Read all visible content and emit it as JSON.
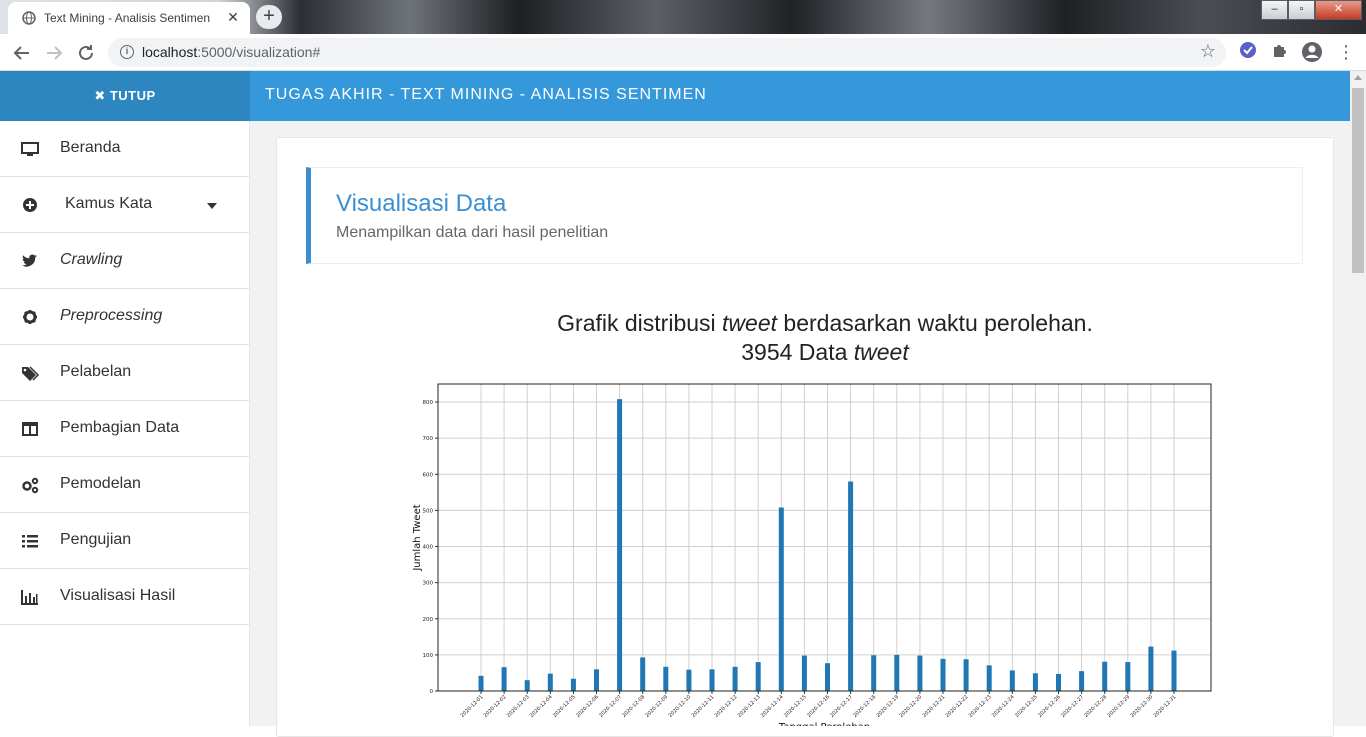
{
  "browser": {
    "tab_title": "Text Mining - Analisis Sentimen",
    "tab_close": "✕",
    "new_tab": "+",
    "url_host": "localhost",
    "url_rest": ":5000/visualization#",
    "win_min": "–",
    "win_max": "▫",
    "win_close": "✕"
  },
  "header": {
    "toggle_label": "✖ TUTUP",
    "app_title": "TUGAS AKHIR - TEXT MINING - ANALISIS SENTIMEN"
  },
  "sidebar": {
    "items": [
      {
        "label": "Beranda",
        "icon": "monitor-icon"
      },
      {
        "label": "Kamus Kata",
        "icon": "plus-circle-icon"
      },
      {
        "label": "Crawling",
        "icon": "twitter-icon"
      },
      {
        "label": "Preprocessing",
        "icon": "gear-icon"
      },
      {
        "label": "Pelabelan",
        "icon": "tags-icon"
      },
      {
        "label": "Pembagian Data",
        "icon": "columns-icon"
      },
      {
        "label": "Pemodelan",
        "icon": "gears-icon"
      },
      {
        "label": "Pengujian",
        "icon": "list-icon"
      },
      {
        "label": "Visualisasi Hasil",
        "icon": "bar-chart-icon"
      }
    ]
  },
  "page": {
    "title": "Visualisasi Data",
    "subtitle": "Menampilkan data dari hasil penelitian"
  },
  "chart_heading": {
    "line1_a": "Grafik distribusi ",
    "line1_em": "tweet",
    "line1_b": " berdasarkan waktu perolehan.",
    "line2_a": "3954 Data ",
    "line2_em": "tweet"
  },
  "chart_data": {
    "type": "bar",
    "ylabel": "Jumlah Tweet",
    "xlabel": "Tanggal Perolehan",
    "ylim": [
      0,
      850
    ],
    "yticks": [
      0,
      100,
      200,
      300,
      400,
      500,
      600,
      700,
      800
    ],
    "grid": true,
    "categories": [
      "2020-12-01",
      "2020-12-02",
      "2020-12-03",
      "2020-12-04",
      "2020-12-05",
      "2020-12-06",
      "2020-12-07",
      "2020-12-08",
      "2020-12-09",
      "2020-12-10",
      "2020-12-11",
      "2020-12-12",
      "2020-12-13",
      "2020-12-14",
      "2020-12-15",
      "2020-12-16",
      "2020-12-17",
      "2020-12-18",
      "2020-12-19",
      "2020-12-20",
      "2020-12-21",
      "2020-12-22",
      "2020-12-23",
      "2020-12-24",
      "2020-12-25",
      "2020-12-26",
      "2020-12-27",
      "2020-12-28",
      "2020-12-29",
      "2020-12-30",
      "2020-12-31"
    ],
    "values": [
      42,
      66,
      30,
      48,
      34,
      60,
      808,
      93,
      67,
      59,
      60,
      67,
      80,
      508,
      98,
      77,
      580,
      99,
      100,
      98,
      89,
      88,
      71,
      57,
      49,
      47,
      55,
      81,
      80,
      123,
      112
    ],
    "bar_color": "#1f77b4"
  }
}
